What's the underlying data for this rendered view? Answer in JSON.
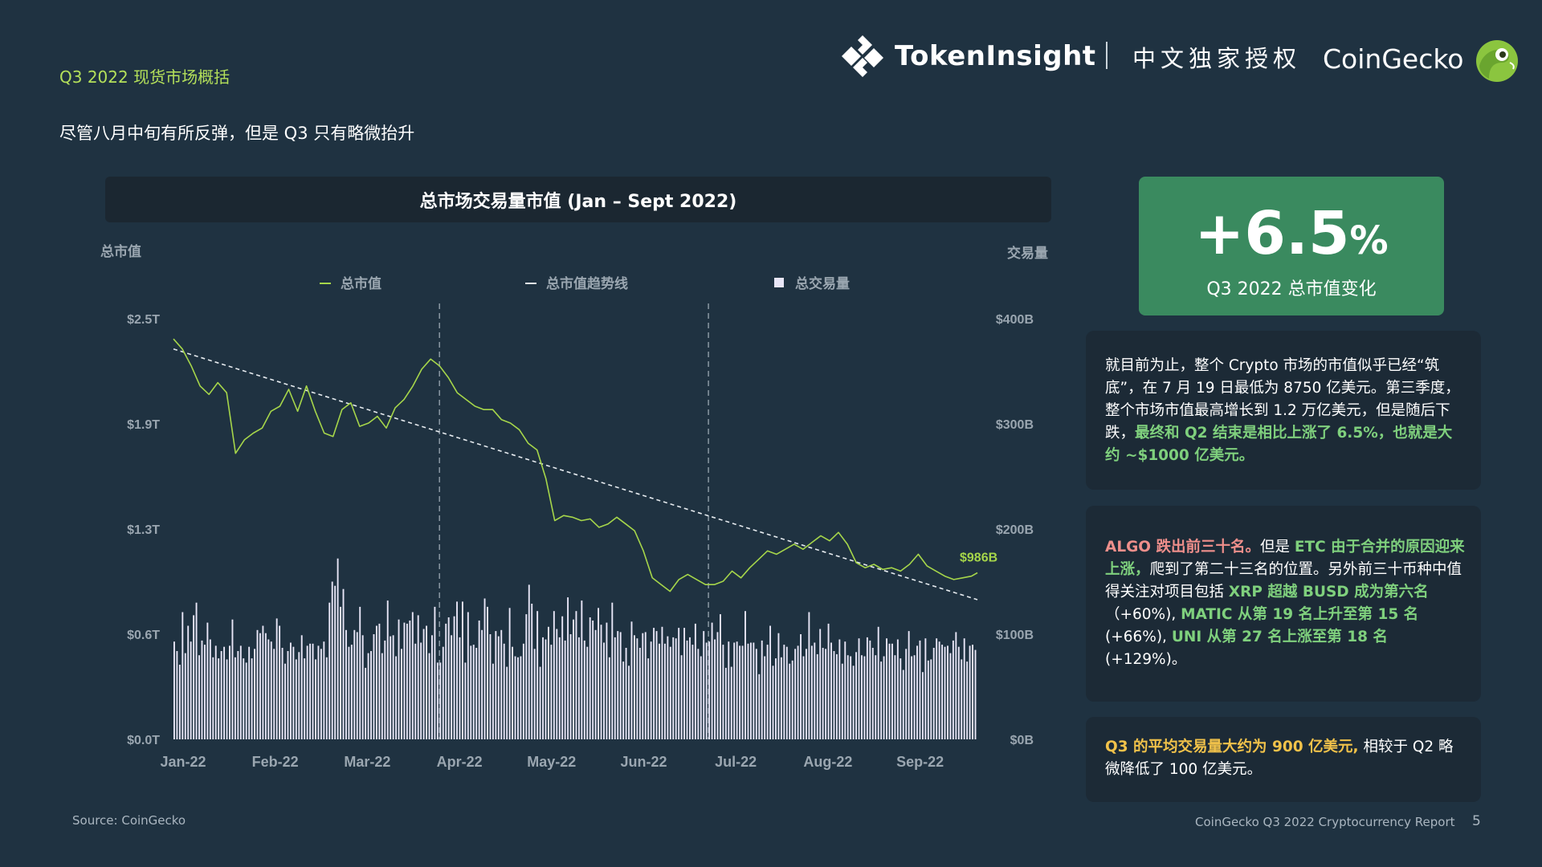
{
  "header": {
    "section_title": "Q3 2022 现货市场概括",
    "subtitle": "尽管八月中旬有所反弹，但是 Q3 只有略微抬升",
    "brand_tokeninsight": "TokenInsight",
    "brand_tokeninsight_cn": "中文独家授权",
    "brand_coingecko": "CoinGecko"
  },
  "colors": {
    "background": "#1f3241",
    "market_cap_line": "#a6d64a",
    "volume_bars": "#e8e6f7",
    "trendline": "#e6ebef",
    "highlight_green": "#7fd07d",
    "highlight_red": "#ef8f8b",
    "highlight_yellow": "#f1c24a",
    "stat_box": "#3a8a5f"
  },
  "chart_data": {
    "type": "line",
    "title": "总市场交易量市值 (Jan – Sept 2022)",
    "y_left_label": "总市值",
    "y_right_label": "交易量",
    "legend": [
      "总市值",
      "总市值趋势线",
      "总交易量"
    ],
    "legend_placement": "top",
    "x_tick_labels": [
      "Jan-22",
      "Feb-22",
      "Mar-22",
      "Apr-22",
      "May-22",
      "Jun-22",
      "Jul-22",
      "Aug-22",
      "Sep-22"
    ],
    "y_left_ticks": [
      "$0.0T",
      "$0.6T",
      "$1.3T",
      "$1.9T",
      "$2.5T"
    ],
    "y_right_ticks": [
      "$0B",
      "$100B",
      "$200B",
      "$300B",
      "$400B"
    ],
    "ylim_left_trillion": [
      0,
      2.5
    ],
    "ylim_right_billion": [
      0,
      400
    ],
    "x_start": "2022-01-01",
    "x_end": "2022-09-30",
    "vertical_reference_dates": [
      "2022-04-01",
      "2022-07-01"
    ],
    "last_value_label": "$986B",
    "market_cap_series": {
      "name": "总市值",
      "unit": "trillion USD",
      "dates": [
        "2022-01-01",
        "2022-01-04",
        "2022-01-07",
        "2022-01-10",
        "2022-01-13",
        "2022-01-16",
        "2022-01-19",
        "2022-01-22",
        "2022-01-25",
        "2022-01-28",
        "2022-01-31",
        "2022-02-03",
        "2022-02-06",
        "2022-02-09",
        "2022-02-12",
        "2022-02-15",
        "2022-02-18",
        "2022-02-21",
        "2022-02-24",
        "2022-02-27",
        "2022-03-02",
        "2022-03-05",
        "2022-03-08",
        "2022-03-11",
        "2022-03-14",
        "2022-03-17",
        "2022-03-20",
        "2022-03-23",
        "2022-03-26",
        "2022-03-29",
        "2022-04-01",
        "2022-04-04",
        "2022-04-07",
        "2022-04-10",
        "2022-04-13",
        "2022-04-16",
        "2022-04-19",
        "2022-04-22",
        "2022-04-25",
        "2022-04-28",
        "2022-05-01",
        "2022-05-04",
        "2022-05-07",
        "2022-05-10",
        "2022-05-13",
        "2022-05-16",
        "2022-05-19",
        "2022-05-22",
        "2022-05-25",
        "2022-05-28",
        "2022-05-31",
        "2022-06-03",
        "2022-06-06",
        "2022-06-09",
        "2022-06-12",
        "2022-06-15",
        "2022-06-18",
        "2022-06-21",
        "2022-06-24",
        "2022-06-27",
        "2022-06-30",
        "2022-07-03",
        "2022-07-06",
        "2022-07-09",
        "2022-07-12",
        "2022-07-15",
        "2022-07-18",
        "2022-07-21",
        "2022-07-24",
        "2022-07-27",
        "2022-07-30",
        "2022-08-02",
        "2022-08-05",
        "2022-08-08",
        "2022-08-11",
        "2022-08-14",
        "2022-08-17",
        "2022-08-20",
        "2022-08-23",
        "2022-08-26",
        "2022-08-29",
        "2022-09-01",
        "2022-09-04",
        "2022-09-07",
        "2022-09-10",
        "2022-09-13",
        "2022-09-16",
        "2022-09-19",
        "2022-09-22",
        "2022-09-25",
        "2022-09-28",
        "2022-09-30"
      ],
      "values": [
        2.38,
        2.32,
        2.22,
        2.1,
        2.05,
        2.12,
        2.06,
        1.7,
        1.78,
        1.82,
        1.85,
        1.95,
        1.98,
        2.08,
        1.95,
        2.1,
        1.95,
        1.82,
        1.8,
        1.96,
        2.0,
        1.86,
        1.88,
        1.92,
        1.85,
        1.97,
        2.02,
        2.1,
        2.2,
        2.26,
        2.22,
        2.15,
        2.06,
        2.02,
        1.98,
        1.96,
        1.96,
        1.9,
        1.88,
        1.84,
        1.76,
        1.72,
        1.55,
        1.3,
        1.33,
        1.32,
        1.3,
        1.31,
        1.26,
        1.28,
        1.32,
        1.28,
        1.24,
        1.12,
        0.96,
        0.92,
        0.88,
        0.95,
        0.98,
        0.95,
        0.92,
        0.92,
        0.94,
        1.0,
        0.96,
        1.02,
        1.07,
        1.12,
        1.1,
        1.13,
        1.16,
        1.13,
        1.17,
        1.21,
        1.18,
        1.23,
        1.16,
        1.05,
        1.02,
        1.04,
        1.01,
        1.02,
        1.0,
        1.04,
        1.1,
        1.03,
        1.0,
        0.97,
        0.95,
        0.96,
        0.97,
        0.99
      ]
    },
    "trendline_series": {
      "name": "总市值趋势线",
      "dates": [
        "2022-01-01",
        "2022-09-30"
      ],
      "values": [
        2.32,
        0.83
      ]
    },
    "volume_series": {
      "name": "总交易量",
      "unit": "billion USD",
      "values": [
        93,
        84,
        71,
        121,
        82,
        108,
        93,
        118,
        130,
        80,
        94,
        90,
        111,
        95,
        78,
        89,
        77,
        84,
        88,
        76,
        89,
        114,
        78,
        84,
        89,
        77,
        73,
        88,
        77,
        86,
        104,
        101,
        108,
        101,
        95,
        93,
        86,
        115,
        108,
        87,
        72,
        84,
        92,
        88,
        76,
        83,
        99,
        77,
        89,
        91,
        91,
        76,
        89,
        86,
        93,
        78,
        130,
        150,
        146,
        172,
        126,
        143,
        104,
        88,
        90,
        104,
        102,
        126,
        99,
        68,
        82,
        84,
        100,
        108,
        110,
        82,
        94,
        132,
        98,
        99,
        79,
        114,
        86,
        111,
        110,
        113,
        121,
        91,
        118,
        92,
        105,
        108,
        82,
        99,
        126,
        73,
        73,
        88,
        110,
        116,
        99,
        117,
        131,
        97,
        131,
        73,
        121,
        89,
        90,
        87,
        113,
        104,
        134,
        126,
        100,
        72,
        103,
        98,
        104,
        91,
        69,
        125,
        88,
        79,
        78,
        79,
        91,
        119,
        147,
        129,
        86,
        122,
        69,
        97,
        95,
        107,
        90,
        122,
        105,
        97,
        117,
        94,
        135,
        100,
        114,
        122,
        97,
        132,
        94,
        88,
        116,
        113,
        104,
        125,
        109,
        92,
        111,
        78,
        130,
        97,
        103,
        102,
        74,
        87,
        70,
        112,
        99,
        96,
        87,
        101,
        102,
        77,
        93,
        106,
        103,
        91,
        107,
        91,
        98,
        88,
        97,
        96,
        106,
        80,
        106,
        94,
        97,
        90,
        110,
        86,
        79,
        103,
        92,
        93,
        111,
        95,
        102,
        119,
        90,
        68,
        93,
        69,
        92,
        93,
        89,
        89,
        122,
        91,
        92,
        92,
        86,
        62,
        94,
        79,
        90,
        108,
        70,
        77,
        101,
        78,
        90,
        88,
        72,
        75,
        86,
        89,
        100,
        79,
        86,
        121,
        89,
        92,
        81,
        105,
        87,
        86,
        110,
        92,
        84,
        81,
        95,
        72,
        93,
        80,
        79,
        70,
        83,
        96,
        80,
        79,
        97,
        94,
        87,
        80,
        107,
        74,
        79,
        96,
        91,
        91,
        80,
        95,
        77,
        66,
        86,
        103,
        79,
        80,
        89,
        94,
        64,
        96,
        75,
        76,
        87,
        96,
        93,
        90,
        88,
        89,
        82,
        94,
        102,
        88,
        76,
        96,
        74,
        89,
        90,
        85
      ]
    }
  },
  "stat": {
    "value": "+6.5",
    "unit": "%",
    "label": "Q3 2022 总市值变化"
  },
  "cards": {
    "c1_a": "就目前为止，整个 Crypto 市场的市值似乎已经“筑底”，在 7 月 19 日最低为 8750 亿美元。第三季度，整个市场市值最高增长到 1.2 万亿美元，但是随后下跌，",
    "c1_b": "最终和 Q2 结束是相比上涨了 6.5%，也就是大约 ~$1000 亿美元。",
    "c2_a": "ALGO 跌出前三十名。",
    "c2_b": "但是 ",
    "c2_c": "ETC 由于合并的原因迎来上涨，",
    "c2_d": "爬到了第二十三名的位置。另外前三十币种中值得关注对项目包括 ",
    "c2_e": "XRP 超越 BUSD 成为第六名",
    "c2_f": "（+60%), ",
    "c2_g": "MATIC 从第 19 名上升至第 15 名",
    "c2_h": " (+66%), ",
    "c2_i": "UNI 从第 27 名上涨至第 18 名",
    "c2_j": " (+129%)。",
    "c3_a": "Q3 的平均交易量大约为 900 亿美元,",
    "c3_b": " 相较于 Q2 略微降低了 100 亿美元。"
  },
  "footer": {
    "source": "Source: CoinGecko",
    "report": "CoinGecko Q3 2022 Cryptocurrency Report",
    "page": "5"
  }
}
